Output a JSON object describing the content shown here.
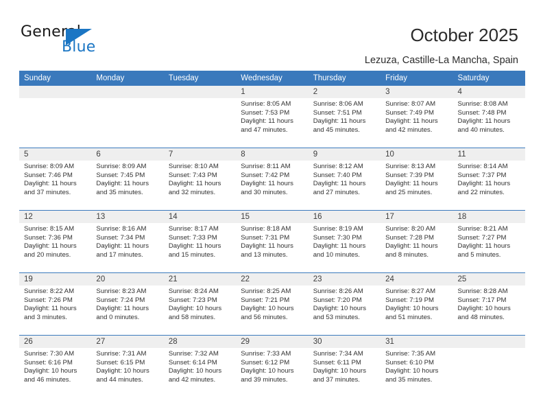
{
  "logo": {
    "word_one": "General",
    "word_two": "Blue",
    "triangle": "triangle-icon"
  },
  "header": {
    "title": "October 2025",
    "location": "Lezuza, Castille-La Mancha, Spain"
  },
  "calendar": {
    "weekday_headers": [
      "Sunday",
      "Monday",
      "Tuesday",
      "Wednesday",
      "Thursday",
      "Friday",
      "Saturday"
    ],
    "accent_color": "#3a79bc",
    "datebar_color": "#efefef",
    "weeks": [
      {
        "days": [
          {
            "num": "",
            "lines": []
          },
          {
            "num": "",
            "lines": []
          },
          {
            "num": "",
            "lines": []
          },
          {
            "num": "1",
            "lines": [
              "Sunrise: 8:05 AM",
              "Sunset: 7:53 PM",
              "Daylight: 11 hours",
              "and 47 minutes."
            ]
          },
          {
            "num": "2",
            "lines": [
              "Sunrise: 8:06 AM",
              "Sunset: 7:51 PM",
              "Daylight: 11 hours",
              "and 45 minutes."
            ]
          },
          {
            "num": "3",
            "lines": [
              "Sunrise: 8:07 AM",
              "Sunset: 7:49 PM",
              "Daylight: 11 hours",
              "and 42 minutes."
            ]
          },
          {
            "num": "4",
            "lines": [
              "Sunrise: 8:08 AM",
              "Sunset: 7:48 PM",
              "Daylight: 11 hours",
              "and 40 minutes."
            ]
          }
        ]
      },
      {
        "days": [
          {
            "num": "5",
            "lines": [
              "Sunrise: 8:09 AM",
              "Sunset: 7:46 PM",
              "Daylight: 11 hours",
              "and 37 minutes."
            ]
          },
          {
            "num": "6",
            "lines": [
              "Sunrise: 8:09 AM",
              "Sunset: 7:45 PM",
              "Daylight: 11 hours",
              "and 35 minutes."
            ]
          },
          {
            "num": "7",
            "lines": [
              "Sunrise: 8:10 AM",
              "Sunset: 7:43 PM",
              "Daylight: 11 hours",
              "and 32 minutes."
            ]
          },
          {
            "num": "8",
            "lines": [
              "Sunrise: 8:11 AM",
              "Sunset: 7:42 PM",
              "Daylight: 11 hours",
              "and 30 minutes."
            ]
          },
          {
            "num": "9",
            "lines": [
              "Sunrise: 8:12 AM",
              "Sunset: 7:40 PM",
              "Daylight: 11 hours",
              "and 27 minutes."
            ]
          },
          {
            "num": "10",
            "lines": [
              "Sunrise: 8:13 AM",
              "Sunset: 7:39 PM",
              "Daylight: 11 hours",
              "and 25 minutes."
            ]
          },
          {
            "num": "11",
            "lines": [
              "Sunrise: 8:14 AM",
              "Sunset: 7:37 PM",
              "Daylight: 11 hours",
              "and 22 minutes."
            ]
          }
        ]
      },
      {
        "days": [
          {
            "num": "12",
            "lines": [
              "Sunrise: 8:15 AM",
              "Sunset: 7:36 PM",
              "Daylight: 11 hours",
              "and 20 minutes."
            ]
          },
          {
            "num": "13",
            "lines": [
              "Sunrise: 8:16 AM",
              "Sunset: 7:34 PM",
              "Daylight: 11 hours",
              "and 17 minutes."
            ]
          },
          {
            "num": "14",
            "lines": [
              "Sunrise: 8:17 AM",
              "Sunset: 7:33 PM",
              "Daylight: 11 hours",
              "and 15 minutes."
            ]
          },
          {
            "num": "15",
            "lines": [
              "Sunrise: 8:18 AM",
              "Sunset: 7:31 PM",
              "Daylight: 11 hours",
              "and 13 minutes."
            ]
          },
          {
            "num": "16",
            "lines": [
              "Sunrise: 8:19 AM",
              "Sunset: 7:30 PM",
              "Daylight: 11 hours",
              "and 10 minutes."
            ]
          },
          {
            "num": "17",
            "lines": [
              "Sunrise: 8:20 AM",
              "Sunset: 7:28 PM",
              "Daylight: 11 hours",
              "and 8 minutes."
            ]
          },
          {
            "num": "18",
            "lines": [
              "Sunrise: 8:21 AM",
              "Sunset: 7:27 PM",
              "Daylight: 11 hours",
              "and 5 minutes."
            ]
          }
        ]
      },
      {
        "days": [
          {
            "num": "19",
            "lines": [
              "Sunrise: 8:22 AM",
              "Sunset: 7:26 PM",
              "Daylight: 11 hours",
              "and 3 minutes."
            ]
          },
          {
            "num": "20",
            "lines": [
              "Sunrise: 8:23 AM",
              "Sunset: 7:24 PM",
              "Daylight: 11 hours",
              "and 0 minutes."
            ]
          },
          {
            "num": "21",
            "lines": [
              "Sunrise: 8:24 AM",
              "Sunset: 7:23 PM",
              "Daylight: 10 hours",
              "and 58 minutes."
            ]
          },
          {
            "num": "22",
            "lines": [
              "Sunrise: 8:25 AM",
              "Sunset: 7:21 PM",
              "Daylight: 10 hours",
              "and 56 minutes."
            ]
          },
          {
            "num": "23",
            "lines": [
              "Sunrise: 8:26 AM",
              "Sunset: 7:20 PM",
              "Daylight: 10 hours",
              "and 53 minutes."
            ]
          },
          {
            "num": "24",
            "lines": [
              "Sunrise: 8:27 AM",
              "Sunset: 7:19 PM",
              "Daylight: 10 hours",
              "and 51 minutes."
            ]
          },
          {
            "num": "25",
            "lines": [
              "Sunrise: 8:28 AM",
              "Sunset: 7:17 PM",
              "Daylight: 10 hours",
              "and 48 minutes."
            ]
          }
        ]
      },
      {
        "days": [
          {
            "num": "26",
            "lines": [
              "Sunrise: 7:30 AM",
              "Sunset: 6:16 PM",
              "Daylight: 10 hours",
              "and 46 minutes."
            ]
          },
          {
            "num": "27",
            "lines": [
              "Sunrise: 7:31 AM",
              "Sunset: 6:15 PM",
              "Daylight: 10 hours",
              "and 44 minutes."
            ]
          },
          {
            "num": "28",
            "lines": [
              "Sunrise: 7:32 AM",
              "Sunset: 6:14 PM",
              "Daylight: 10 hours",
              "and 42 minutes."
            ]
          },
          {
            "num": "29",
            "lines": [
              "Sunrise: 7:33 AM",
              "Sunset: 6:12 PM",
              "Daylight: 10 hours",
              "and 39 minutes."
            ]
          },
          {
            "num": "30",
            "lines": [
              "Sunrise: 7:34 AM",
              "Sunset: 6:11 PM",
              "Daylight: 10 hours",
              "and 37 minutes."
            ]
          },
          {
            "num": "31",
            "lines": [
              "Sunrise: 7:35 AM",
              "Sunset: 6:10 PM",
              "Daylight: 10 hours",
              "and 35 minutes."
            ]
          },
          {
            "num": "",
            "lines": []
          }
        ]
      }
    ]
  }
}
